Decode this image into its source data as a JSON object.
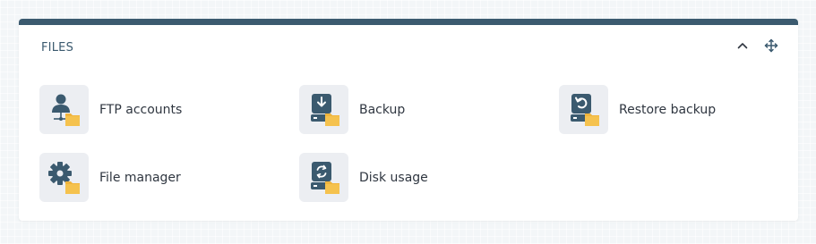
{
  "panel": {
    "title": "FILES",
    "collapse_icon": "chevron-up-icon",
    "move_icon": "move-arrows-icon"
  },
  "items": [
    {
      "label": "FTP accounts",
      "icon": "ftp-user-folder-icon"
    },
    {
      "label": "Backup",
      "icon": "backup-drive-folder-icon"
    },
    {
      "label": "Restore backup",
      "icon": "restore-drive-folder-icon"
    },
    {
      "label": "File manager",
      "icon": "gear-folder-icon"
    },
    {
      "label": "Disk usage",
      "icon": "disk-usage-folder-icon"
    }
  ],
  "colors": {
    "accent": "#3b5a6f",
    "folder": "#f0b43c",
    "tile_bg": "#eceef2"
  }
}
